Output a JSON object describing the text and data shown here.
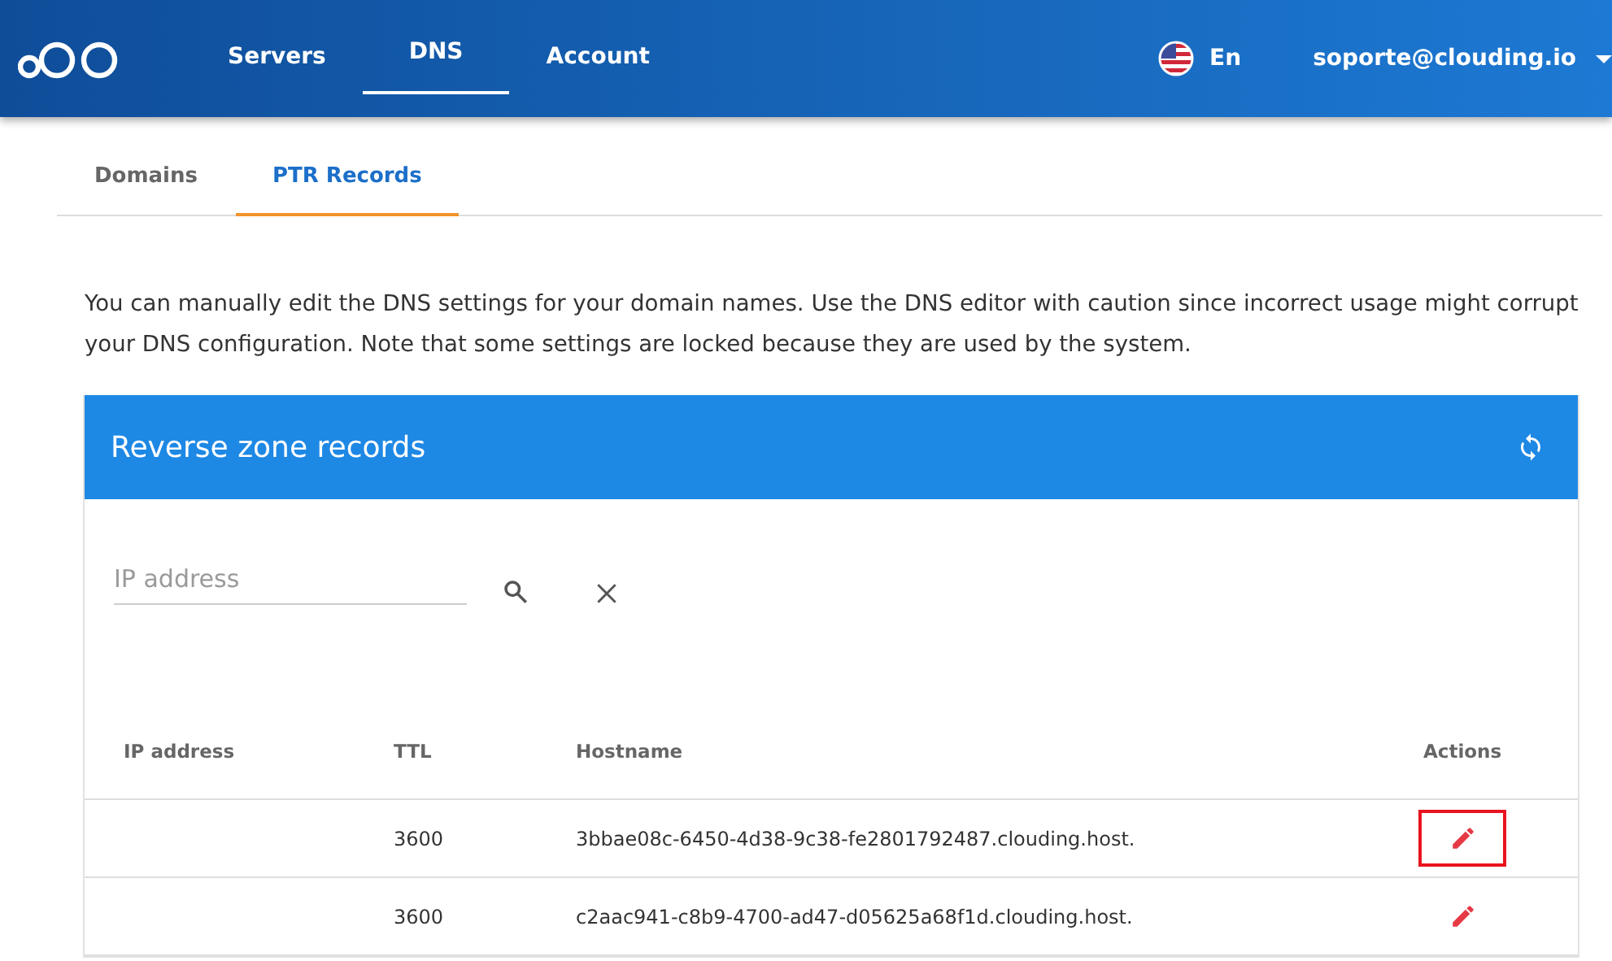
{
  "nav": {
    "items": [
      {
        "label": "Servers",
        "selected": false
      },
      {
        "label": "DNS",
        "selected": true
      },
      {
        "label": "Account",
        "selected": false
      }
    ],
    "language": "En",
    "user": "soporte@clouding.io"
  },
  "tabs": [
    {
      "label": "Domains",
      "selected": false
    },
    {
      "label": "PTR Records",
      "selected": true
    }
  ],
  "intro": "You can manually edit the DNS settings for your domain names. Use the DNS editor with caution since incorrect usage might corrupt your DNS configuration. Note that some settings are locked because they are used by the system.",
  "card": {
    "title": "Reverse zone records",
    "search": {
      "placeholder": "IP address"
    },
    "table": {
      "columns": [
        "IP address",
        "TTL",
        "Hostname",
        "Actions"
      ],
      "rows": [
        {
          "ttl": "3600",
          "hostname": "3bbae08c-6450-4d38-9c38-fe2801792487.clouding.host.",
          "highlighted": true
        },
        {
          "ttl": "3600",
          "hostname": "c2aac941-c8b9-4700-ad47-d05625a68f1d.clouding.host.",
          "highlighted": false
        }
      ]
    }
  }
}
